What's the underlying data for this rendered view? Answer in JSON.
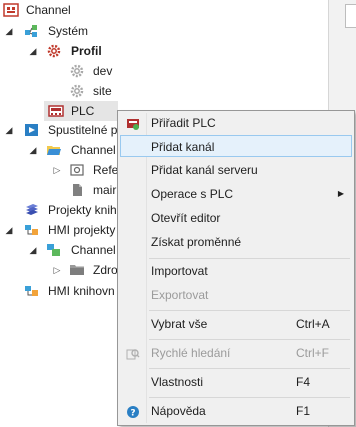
{
  "tree": {
    "items": [
      {
        "label": "Channel",
        "bold": false
      },
      {
        "label": "Systém",
        "bold": false
      },
      {
        "label": "Profil",
        "bold": true
      },
      {
        "label": "dev",
        "bold": false
      },
      {
        "label": "site",
        "bold": false
      },
      {
        "label": "PLC",
        "bold": false
      },
      {
        "label": "Spustitelné p",
        "bold": false
      },
      {
        "label": "Channel",
        "bold": false
      },
      {
        "label": "Refe",
        "bold": false
      },
      {
        "label": "mair",
        "bold": false
      },
      {
        "label": "Projekty knih",
        "bold": false
      },
      {
        "label": "HMI projekty",
        "bold": false
      },
      {
        "label": "Channel",
        "bold": false
      },
      {
        "label": "Zdro",
        "bold": false
      },
      {
        "label": "HMI knihovn",
        "bold": false
      }
    ]
  },
  "context_menu": {
    "items": [
      {
        "label": "Přiřadit PLC",
        "shortcut": "",
        "disabled": false,
        "highlighted": false,
        "icon": "plc-assign-icon"
      },
      {
        "label": "Přidat kanál",
        "shortcut": "",
        "disabled": false,
        "highlighted": true,
        "icon": ""
      },
      {
        "label": "Přidat kanál serveru",
        "shortcut": "",
        "disabled": false,
        "highlighted": false,
        "icon": ""
      },
      {
        "label": "Operace s PLC",
        "shortcut": "",
        "disabled": false,
        "highlighted": false,
        "icon": "",
        "submenu": true
      },
      {
        "label": "Otevřít editor",
        "shortcut": "",
        "disabled": false,
        "highlighted": false,
        "icon": ""
      },
      {
        "label": "Získat proměnné",
        "shortcut": "",
        "disabled": false,
        "highlighted": false,
        "icon": ""
      },
      {
        "label": "Importovat",
        "shortcut": "",
        "disabled": false,
        "highlighted": false,
        "icon": ""
      },
      {
        "label": "Exportovat",
        "shortcut": "",
        "disabled": true,
        "highlighted": false,
        "icon": ""
      },
      {
        "label": "Vybrat vše",
        "shortcut": "Ctrl+A",
        "disabled": false,
        "highlighted": false,
        "icon": ""
      },
      {
        "label": "Rychlé hledání",
        "shortcut": "Ctrl+F",
        "disabled": true,
        "highlighted": false,
        "icon": "quick-search-icon"
      },
      {
        "label": "Vlastnosti",
        "shortcut": "F4",
        "disabled": false,
        "highlighted": false,
        "icon": ""
      },
      {
        "label": "Nápověda",
        "shortcut": "F1",
        "disabled": false,
        "highlighted": false,
        "icon": "help-icon"
      }
    ],
    "submenu_arrow": "▶"
  },
  "colors": {
    "highlight_bg": "#e5f1fb",
    "highlight_border": "#99c9ef",
    "menu_bg": "#f0f0f0",
    "selection_bg": "#e5e5e5",
    "gear_red": "#c0392b",
    "gear_gray": "#a0a0a0"
  }
}
